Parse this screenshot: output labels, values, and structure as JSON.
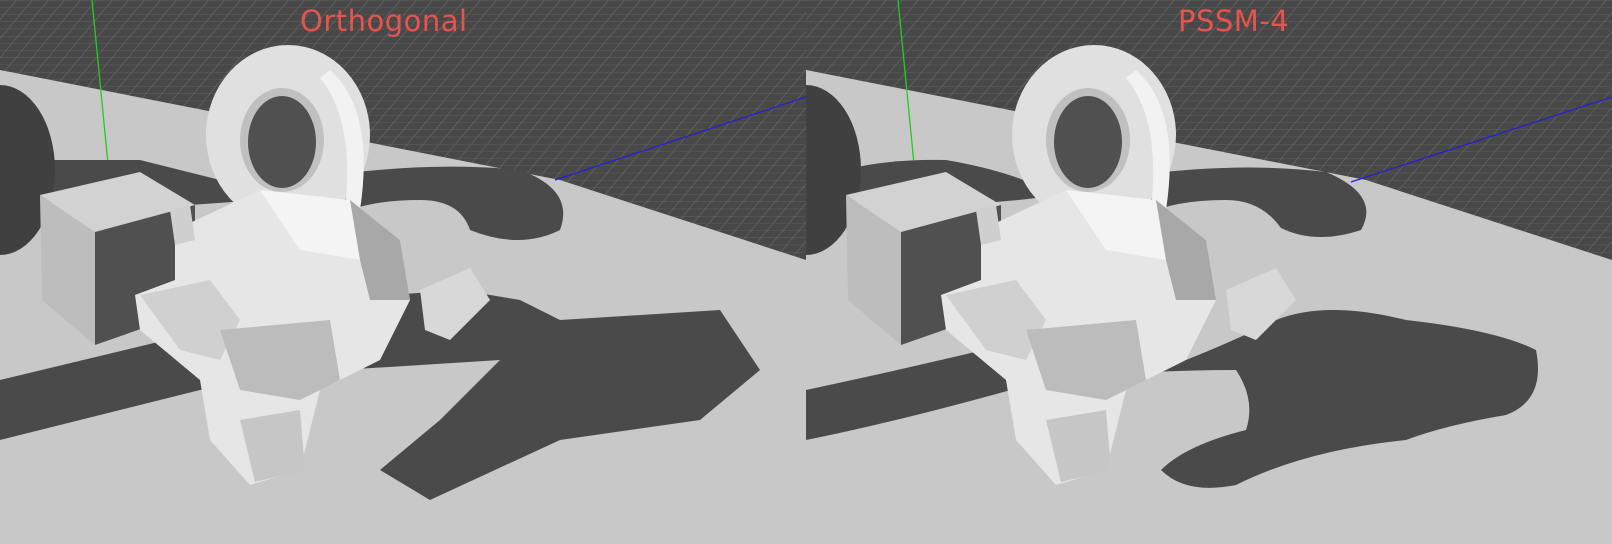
{
  "viewports": [
    {
      "label": "Orthogonal",
      "shadow_style": "blocky"
    },
    {
      "label": "PSSM-4",
      "shadow_style": "smooth"
    }
  ],
  "colors": {
    "label": "#e8524f",
    "floor": "#c8c8c8",
    "grid_bg": "#484848",
    "grid_line": "#6a6a6a",
    "shadow": "#4a4a4a",
    "axis_y": "#22cc22",
    "axis_x": "#2222cc"
  },
  "scene_objects": [
    "sphere",
    "cube",
    "torus",
    "monkey-head"
  ]
}
